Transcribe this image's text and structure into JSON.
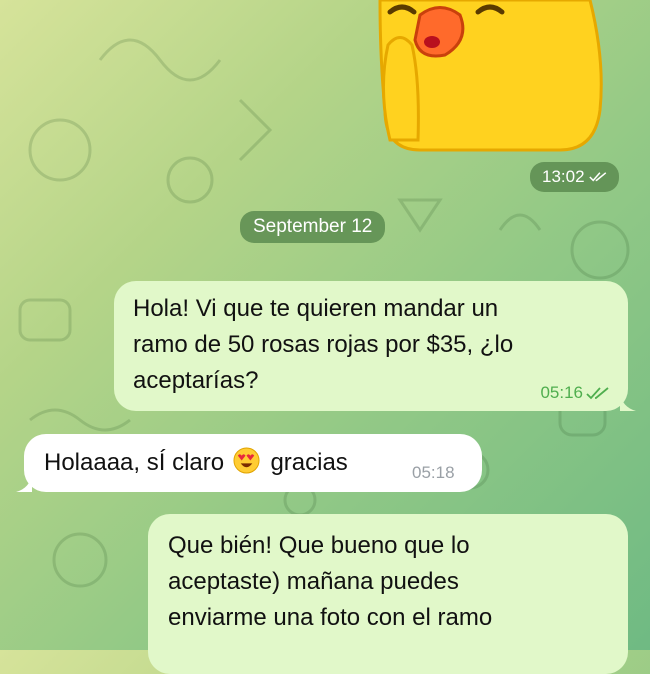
{
  "chat": {
    "sticker": {
      "time": "13:02",
      "status_icon": "double-check-icon"
    },
    "date_separator": "September 12",
    "messages": [
      {
        "direction": "outgoing",
        "lines": [
          "Hola! Vi que te quieren mandar un",
          "ramo de 50 rosas rojas por $35, ¿lo",
          "aceptarías?"
        ],
        "time": "05:16",
        "status_icon": "double-check-icon"
      },
      {
        "direction": "incoming",
        "text_before_emoji": "Holaaaa, sÍ claro",
        "emoji": "heart-eyes-emoji",
        "text_after_emoji": "gracias",
        "time": "05:18"
      },
      {
        "direction": "outgoing",
        "lines": [
          "Que bién! Que bueno que lo",
          "aceptaste) mañana puedes",
          "enviarme una foto con el ramo"
        ]
      }
    ]
  },
  "colors": {
    "outgoing_bubble": "#e1f8c9",
    "incoming_bubble": "#ffffff",
    "outgoing_time": "#4fae4e",
    "incoming_time": "#9aa0a6"
  }
}
